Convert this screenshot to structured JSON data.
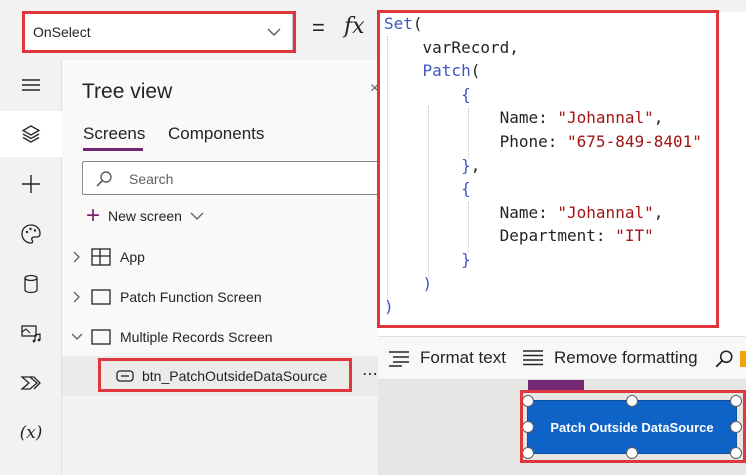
{
  "formula_bar": {
    "property": "OnSelect",
    "equals": "=",
    "fx": "fx"
  },
  "rail": {
    "items": [
      "hamburger-icon",
      "layers-icon",
      "plus-icon",
      "palette-icon",
      "database-icon",
      "media-icon",
      "power-automate-icon",
      "variables-icon"
    ],
    "variables_label": "(x)"
  },
  "tree": {
    "title": "Tree view",
    "tabs": [
      "Screens",
      "Components"
    ],
    "search_placeholder": "Search",
    "new_screen_label": "New screen",
    "nodes": [
      "App",
      "Patch Function Screen",
      "Multiple Records Screen"
    ],
    "selected_control": "btn_PatchOutsideDataSource",
    "more": "⋯"
  },
  "code_lines": [
    "Set(",
    "    varRecord,",
    "    Patch(",
    "        {",
    "            Name: \"Johannal\",",
    "            Phone: \"675-849-8401\"",
    "        },",
    "        {",
    "            Name: \"Johannal\",",
    "            Department: \"IT\"",
    "        }",
    "    )",
    ")"
  ],
  "toolbar": {
    "format_text": "Format text",
    "remove_formatting": "Remove formatting"
  },
  "canvas": {
    "button_text": "Patch Outside DataSource"
  },
  "colors": {
    "accent": "#742774",
    "highlight": "#e0373f",
    "button": "#0f63c7"
  }
}
